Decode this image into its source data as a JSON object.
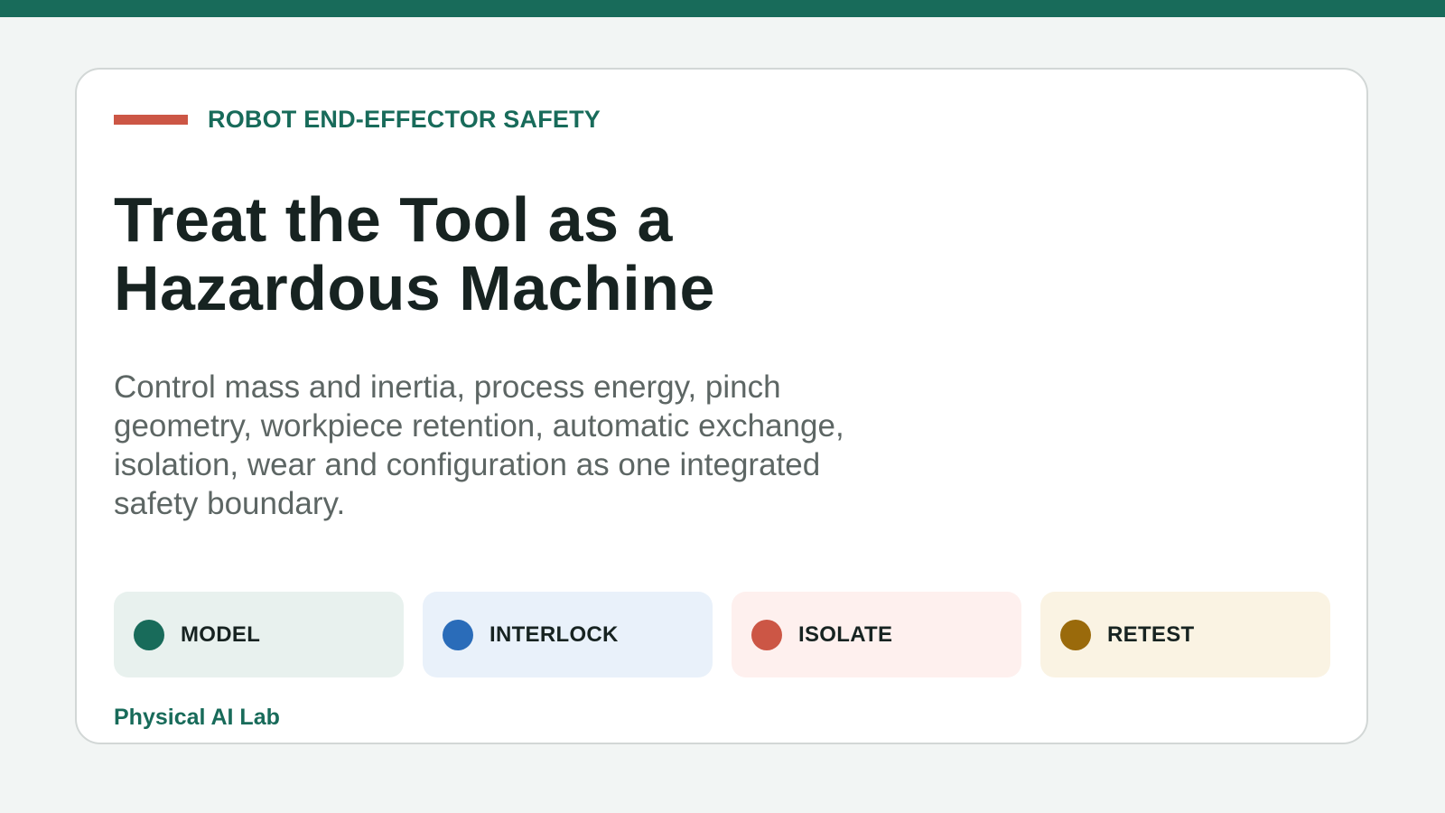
{
  "eyebrow": "ROBOT END-EFFECTOR SAFETY",
  "title_lines": [
    "Treat the Tool as a",
    "Hazardous Machine"
  ],
  "lede": "Control mass and inertia, process energy, pinch geometry, workpiece retention, automatic exchange, isolation, wear and configuration as one integrated safety boundary.",
  "chips": [
    {
      "label": "MODEL",
      "dot": "#186b5a",
      "bg": "#e8f1ee"
    },
    {
      "label": "INTERLOCK",
      "dot": "#2a6cb9",
      "bg": "#e9f1fa"
    },
    {
      "label": "ISOLATE",
      "dot": "#cc5645",
      "bg": "#fef0ee"
    },
    {
      "label": "RETEST",
      "dot": "#9a6a0b",
      "bg": "#faf3e3"
    }
  ],
  "footer": "Physical AI Lab",
  "colors": {
    "brand": "#186b5a",
    "accent": "#cc5645",
    "background": "#f2f5f4",
    "card": "#ffffff",
    "title": "#172321",
    "body_text": "#5d6664"
  }
}
